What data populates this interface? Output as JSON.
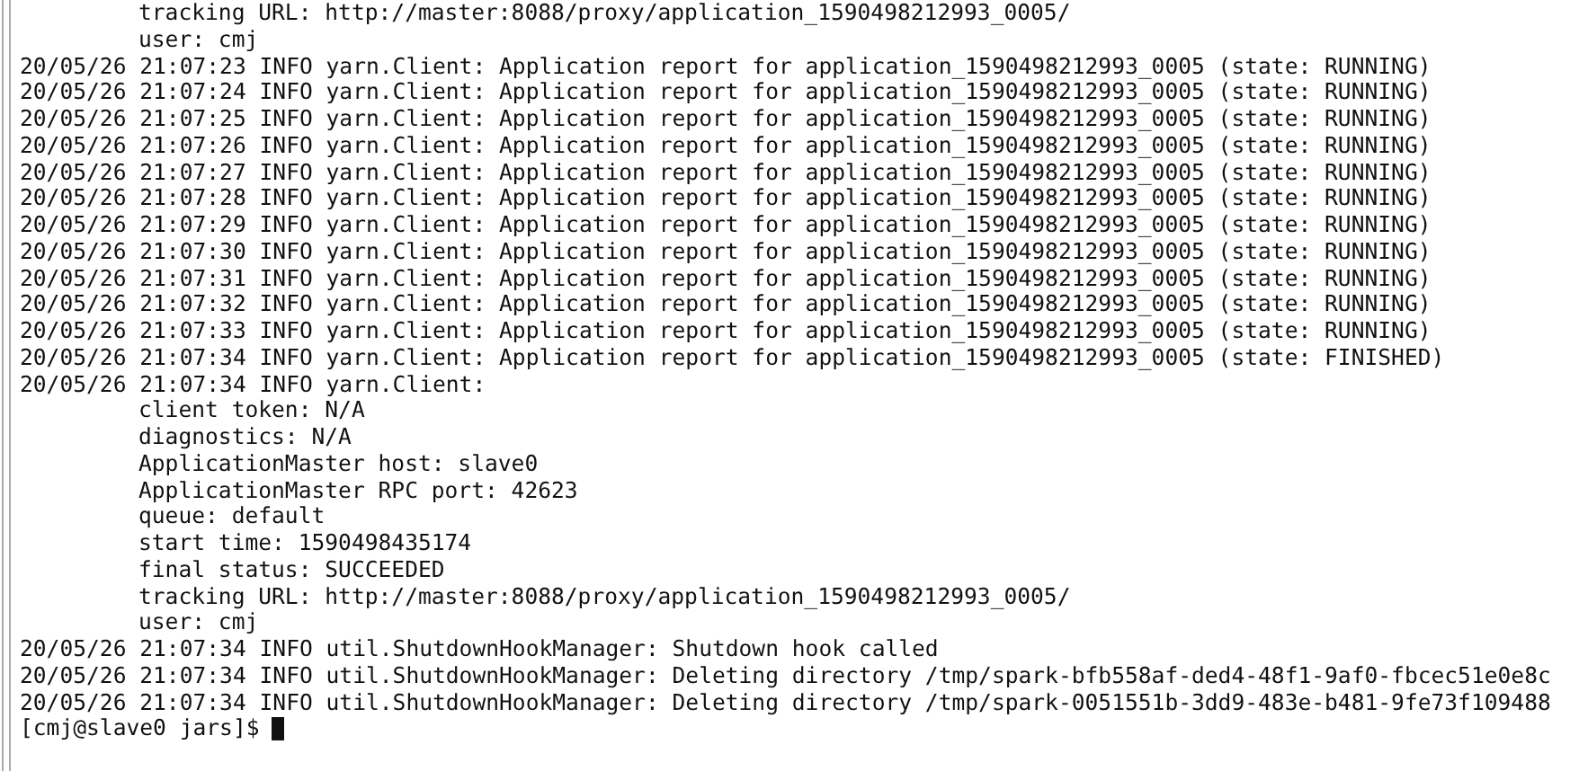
{
  "terminal": {
    "lines": [
      {
        "kind": "field",
        "text": "tracking URL: http://master:8088/proxy/application_1590498212993_0005/"
      },
      {
        "kind": "field",
        "text": "user: cmj"
      },
      {
        "kind": "log",
        "text": "20/05/26 21:07:23 INFO yarn.Client: Application report for application_1590498212993_0005 (state: RUNNING)"
      },
      {
        "kind": "log",
        "text": "20/05/26 21:07:24 INFO yarn.Client: Application report for application_1590498212993_0005 (state: RUNNING)"
      },
      {
        "kind": "log",
        "text": "20/05/26 21:07:25 INFO yarn.Client: Application report for application_1590498212993_0005 (state: RUNNING)"
      },
      {
        "kind": "log",
        "text": "20/05/26 21:07:26 INFO yarn.Client: Application report for application_1590498212993_0005 (state: RUNNING)"
      },
      {
        "kind": "log",
        "text": "20/05/26 21:07:27 INFO yarn.Client: Application report for application_1590498212993_0005 (state: RUNNING)"
      },
      {
        "kind": "log",
        "text": "20/05/26 21:07:28 INFO yarn.Client: Application report for application_1590498212993_0005 (state: RUNNING)"
      },
      {
        "kind": "log",
        "text": "20/05/26 21:07:29 INFO yarn.Client: Application report for application_1590498212993_0005 (state: RUNNING)"
      },
      {
        "kind": "log",
        "text": "20/05/26 21:07:30 INFO yarn.Client: Application report for application_1590498212993_0005 (state: RUNNING)"
      },
      {
        "kind": "log",
        "text": "20/05/26 21:07:31 INFO yarn.Client: Application report for application_1590498212993_0005 (state: RUNNING)"
      },
      {
        "kind": "log",
        "text": "20/05/26 21:07:32 INFO yarn.Client: Application report for application_1590498212993_0005 (state: RUNNING)"
      },
      {
        "kind": "log",
        "text": "20/05/26 21:07:33 INFO yarn.Client: Application report for application_1590498212993_0005 (state: RUNNING)"
      },
      {
        "kind": "log",
        "text": "20/05/26 21:07:34 INFO yarn.Client: Application report for application_1590498212993_0005 (state: FINISHED)"
      },
      {
        "kind": "log",
        "text": "20/05/26 21:07:34 INFO yarn.Client:"
      },
      {
        "kind": "field",
        "text": "client token: N/A"
      },
      {
        "kind": "field",
        "text": "diagnostics: N/A"
      },
      {
        "kind": "field",
        "text": "ApplicationMaster host: slave0"
      },
      {
        "kind": "field",
        "text": "ApplicationMaster RPC port: 42623"
      },
      {
        "kind": "field",
        "text": "queue: default"
      },
      {
        "kind": "field",
        "text": "start time: 1590498435174"
      },
      {
        "kind": "field",
        "text": "final status: SUCCEEDED"
      },
      {
        "kind": "field",
        "text": "tracking URL: http://master:8088/proxy/application_1590498212993_0005/"
      },
      {
        "kind": "field",
        "text": "user: cmj"
      },
      {
        "kind": "log",
        "text": "20/05/26 21:07:34 INFO util.ShutdownHookManager: Shutdown hook called"
      },
      {
        "kind": "log",
        "text": "20/05/26 21:07:34 INFO util.ShutdownHookManager: Deleting directory /tmp/spark-bfb558af-ded4-48f1-9af0-fbcec51e0e8c"
      },
      {
        "kind": "log",
        "text": "20/05/26 21:07:34 INFO util.ShutdownHookManager: Deleting directory /tmp/spark-0051551b-3dd9-483e-b481-9fe73f109488"
      }
    ],
    "prompt": "[cmj@slave0 jars]$"
  }
}
